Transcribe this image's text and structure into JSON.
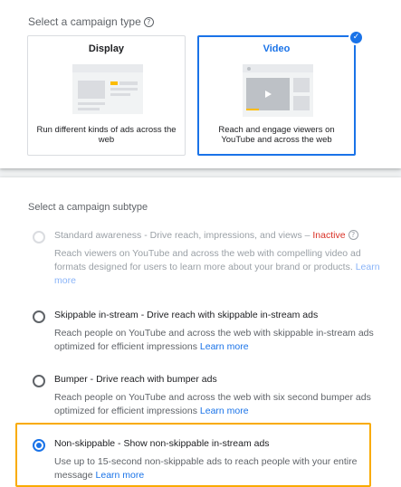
{
  "campaign_type": {
    "label": "Select a campaign type",
    "help_icon": "?",
    "cards": [
      {
        "title": "Display",
        "description": "Run different kinds of ads across the web",
        "selected": false
      },
      {
        "title": "Video",
        "description": "Reach and engage viewers on YouTube and across the web",
        "selected": true
      }
    ],
    "selected_check_icon": "✓"
  },
  "campaign_subtype": {
    "label": "Select a campaign subtype",
    "options": [
      {
        "title": "Standard awareness - Drive reach, impressions, and views – ",
        "status": "Inactive",
        "help_icon": "?",
        "description": "Reach viewers on YouTube and across the web with compelling video ad formats designed for users to learn more about your brand or products.",
        "learn_more": "Learn more",
        "state": "disabled"
      },
      {
        "title": "Skippable in-stream - Drive reach with skippable in-stream ads",
        "description": "Reach people on YouTube and across the web with skippable in-stream ads optimized for efficient impressions",
        "learn_more": "Learn more",
        "state": "unselected"
      },
      {
        "title": "Bumper - Drive reach with bumper ads",
        "description": "Reach people on YouTube and across the web with six second bumper ads optimized for efficient impressions",
        "learn_more": "Learn more",
        "state": "unselected"
      },
      {
        "title": "Non-skippable - Show non-skippable in-stream ads",
        "description": "Use up to 15-second non-skippable ads to reach people with your entire message",
        "learn_more": "Learn more",
        "state": "selected"
      }
    ]
  },
  "colors": {
    "accent": "#1a73e8",
    "highlight": "#f9ab00",
    "inactive": "#d93025"
  }
}
